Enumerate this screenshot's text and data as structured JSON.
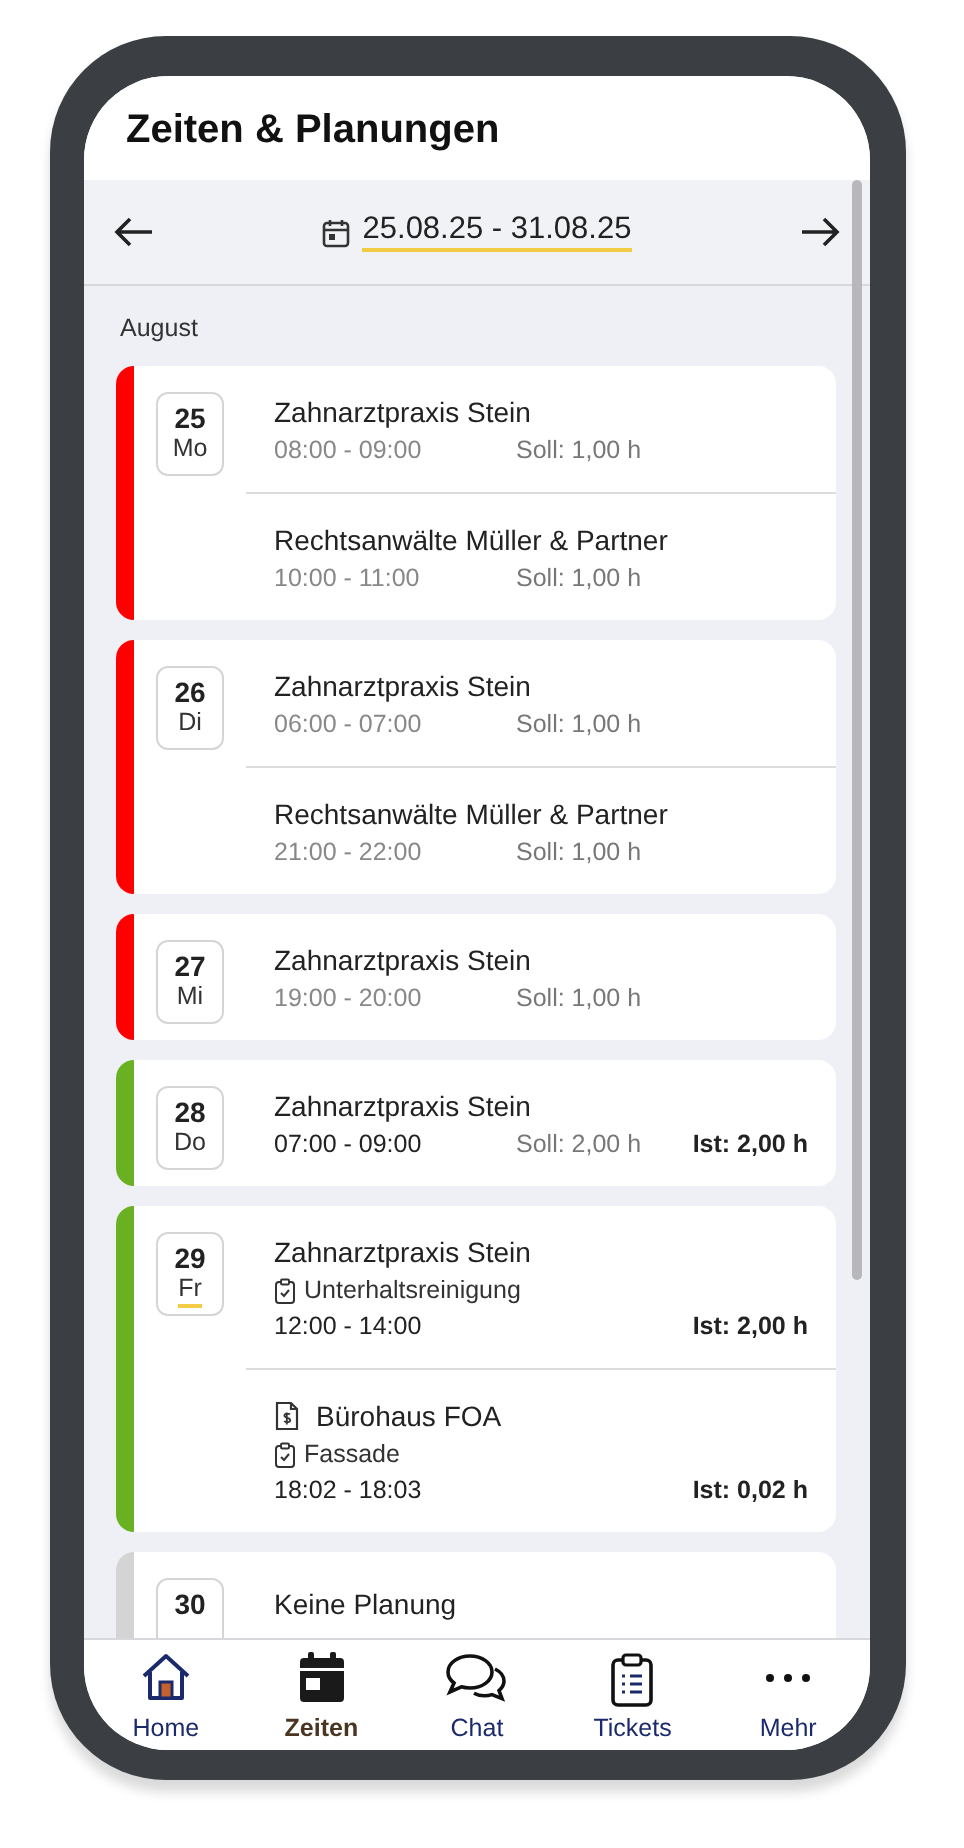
{
  "title": "Zeiten & Planungen",
  "week": {
    "range": "25.08.25 - 31.08.25"
  },
  "month": "August",
  "days": [
    {
      "day": "25",
      "weekday": "Mo",
      "today": false,
      "color": "#ff0000",
      "entries": [
        {
          "kind": "plan",
          "title": "Zahnarztpraxis Stein",
          "time": "08:00 - 09:00",
          "soll": "Soll: 1,00 h"
        },
        {
          "kind": "plan",
          "title": "Rechtsanwälte Müller & Partner",
          "time": "10:00 - 11:00",
          "soll": "Soll: 1,00 h"
        }
      ]
    },
    {
      "day": "26",
      "weekday": "Di",
      "today": false,
      "color": "#ff0000",
      "entries": [
        {
          "kind": "plan",
          "title": "Zahnarztpraxis Stein",
          "time": "06:00 - 07:00",
          "soll": "Soll: 1,00 h"
        },
        {
          "kind": "plan",
          "title": "Rechtsanwälte Müller & Partner",
          "time": "21:00 - 22:00",
          "soll": "Soll: 1,00 h"
        }
      ]
    },
    {
      "day": "27",
      "weekday": "Mi",
      "today": false,
      "color": "#ff0000",
      "entries": [
        {
          "kind": "plan",
          "title": "Zahnarztpraxis Stein",
          "time": "19:00 - 20:00",
          "soll": "Soll: 1,00 h"
        }
      ]
    },
    {
      "day": "28",
      "weekday": "Do",
      "today": false,
      "color": "#6ab023",
      "entries": [
        {
          "kind": "plan",
          "title": "Zahnarztpraxis Stein",
          "time": "07:00 - 09:00",
          "soll": "Soll: 2,00 h",
          "ist": "Ist: 2,00 h"
        }
      ]
    },
    {
      "day": "29",
      "weekday": "Fr",
      "today": true,
      "color": "#6ab023",
      "entries": [
        {
          "kind": "plan",
          "title": "Zahnarztpraxis Stein",
          "task": "Unterhaltsreinigung",
          "time": "12:00 - 14:00",
          "ist": "Ist: 2,00 h"
        },
        {
          "kind": "document",
          "title": "Bürohaus FOA",
          "task": "Fassade",
          "time": "18:02 - 18:03",
          "ist": "Ist: 0,02 h"
        }
      ]
    },
    {
      "day": "30",
      "color": "#d4d4d4",
      "entries": [
        {
          "kind": "empty",
          "title": "Keine Planung"
        }
      ]
    }
  ],
  "nav": [
    {
      "kind": "home",
      "label": "Home",
      "selected": false
    },
    {
      "kind": "calendar",
      "label": "Zeiten",
      "selected": true
    },
    {
      "kind": "chat",
      "label": "Chat",
      "selected": false
    },
    {
      "kind": "tickets",
      "label": "Tickets",
      "selected": false
    },
    {
      "kind": "more",
      "label": "Mehr",
      "selected": false
    }
  ]
}
